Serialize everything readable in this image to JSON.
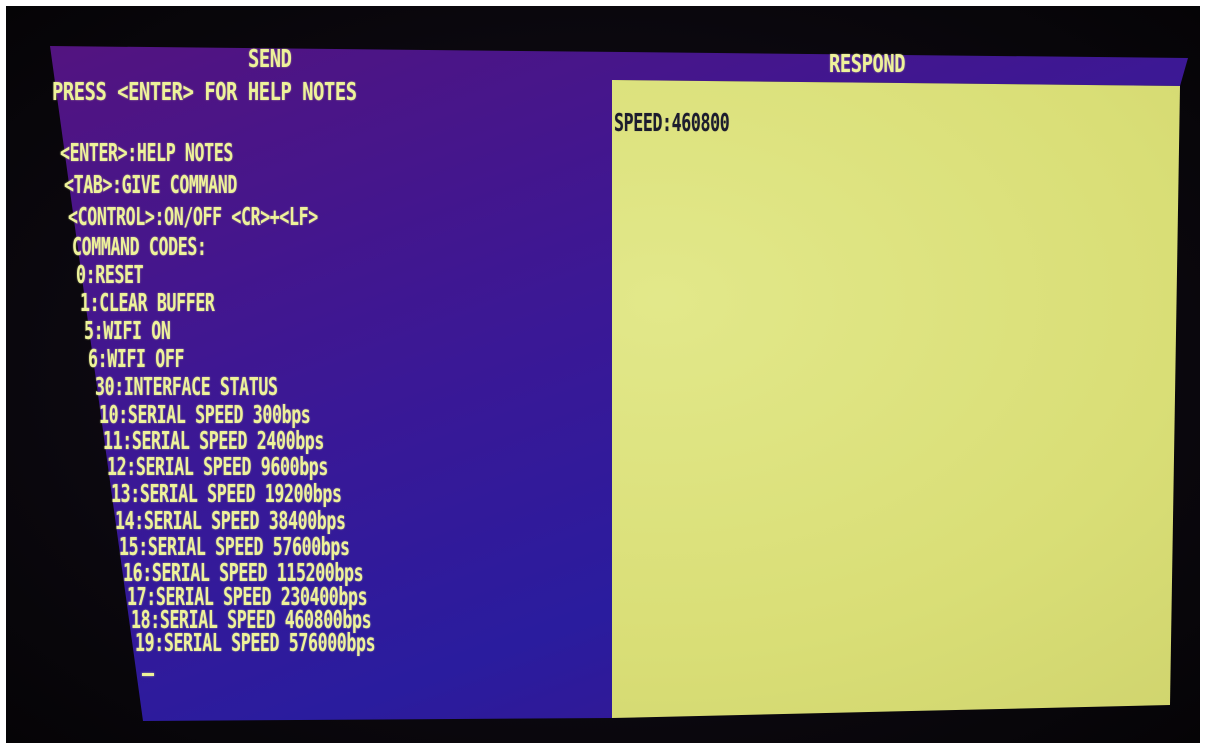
{
  "send": {
    "title": "SEND",
    "prompt": "PRESS <ENTER> FOR HELP NOTES",
    "help_lines": [
      "<ENTER>:HELP NOTES",
      "<TAB>:GIVE COMMAND",
      "<CONTROL>:ON/OFF <CR>+<LF>",
      "COMMAND CODES:",
      "0:RESET",
      "1:CLEAR BUFFER",
      "5:WIFI ON",
      "6:WIFI OFF",
      "30:INTERFACE STATUS",
      "10:SERIAL SPEED 300bps",
      "11:SERIAL SPEED 2400bps",
      "12:SERIAL SPEED 9600bps",
      "13:SERIAL SPEED 19200bps",
      "14:SERIAL SPEED 38400bps",
      "15:SERIAL SPEED 57600bps",
      "16:SERIAL SPEED 115200bps",
      "17:SERIAL SPEED 230400bps",
      "18:SERIAL SPEED 460800bps",
      "19:SERIAL SPEED 576000bps"
    ]
  },
  "respond": {
    "title": "RESPOND",
    "output_line": "SPEED:460800"
  },
  "colors": {
    "send_background": "#3a1896",
    "respond_background": "#dde27e",
    "text": "#eef29a",
    "respond_text": "#1c1c2e",
    "bezel": "#0a070d"
  }
}
